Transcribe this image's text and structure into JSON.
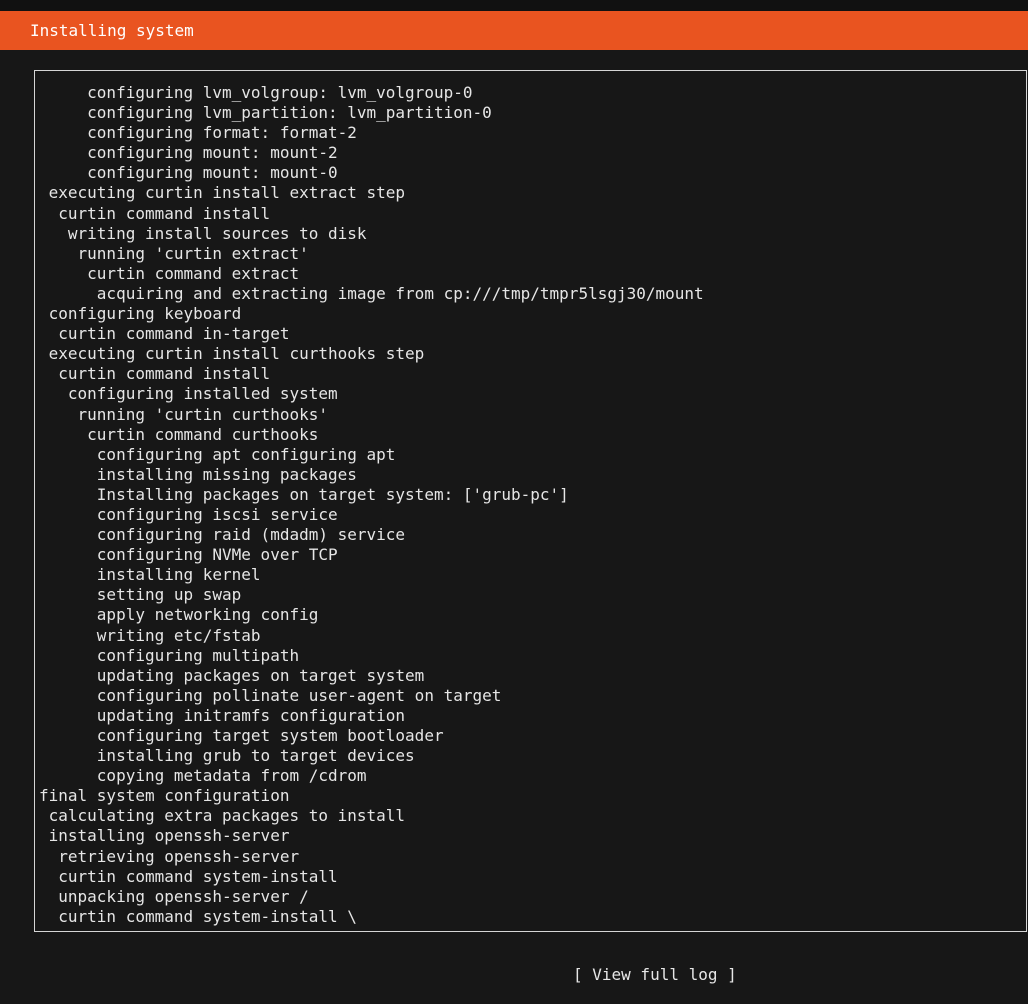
{
  "header": {
    "title": "Installing system"
  },
  "log": {
    "lines": [
      "     configuring lvm_volgroup: lvm_volgroup-0",
      "     configuring lvm_partition: lvm_partition-0",
      "     configuring format: format-2",
      "     configuring mount: mount-2",
      "     configuring mount: mount-0",
      " executing curtin install extract step",
      "  curtin command install",
      "   writing install sources to disk",
      "    running 'curtin extract'",
      "     curtin command extract",
      "      acquiring and extracting image from cp:///tmp/tmpr5lsgj30/mount",
      " configuring keyboard",
      "  curtin command in-target",
      " executing curtin install curthooks step",
      "  curtin command install",
      "   configuring installed system",
      "    running 'curtin curthooks'",
      "     curtin command curthooks",
      "      configuring apt configuring apt",
      "      installing missing packages",
      "      Installing packages on target system: ['grub-pc']",
      "      configuring iscsi service",
      "      configuring raid (mdadm) service",
      "      configuring NVMe over TCP",
      "      installing kernel",
      "      setting up swap",
      "      apply networking config",
      "      writing etc/fstab",
      "      configuring multipath",
      "      updating packages on target system",
      "      configuring pollinate user-agent on target",
      "      updating initramfs configuration",
      "      configuring target system bootloader",
      "      installing grub to target devices",
      "      copying metadata from /cdrom",
      "final system configuration",
      " calculating extra packages to install",
      " installing openssh-server",
      "  retrieving openssh-server",
      "  curtin command system-install",
      "  unpacking openssh-server /",
      "  curtin command system-install \\"
    ]
  },
  "footer": {
    "view_full_log_label": "[ View full log ]"
  },
  "colors": {
    "header_background": "#e95420",
    "background": "#171717",
    "text": "#e6e6e6",
    "border": "#d6d6d6"
  }
}
